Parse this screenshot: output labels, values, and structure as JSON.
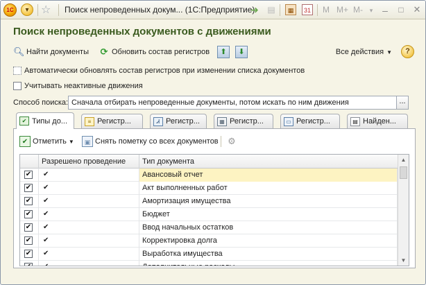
{
  "titlebar": {
    "logo": "1С",
    "title": "Поиск непроведенных докум... (1С:Предприятие)",
    "memory_buttons": [
      "M",
      "M+",
      "M-"
    ]
  },
  "heading": "Поиск непроведенных документов с движениями",
  "toolbar": {
    "find_label": "Найти документы",
    "refresh_label": "Обновить состав регистров",
    "all_actions_label": "Все действия",
    "help_label": "?"
  },
  "options": {
    "auto_refresh_label": "Автоматически обновлять состав регистров при изменении списка документов",
    "inactive_label": "Учитывать неактивные движения"
  },
  "search_mode": {
    "label": "Способ поиска:",
    "value": "Сначала отбирать непроведенные документы, потом искать по ним движения",
    "button": "..."
  },
  "tabs": [
    {
      "label": "Типы до...",
      "icon": "document-types-icon"
    },
    {
      "label": "Регистр...",
      "icon": "register-icon"
    },
    {
      "label": "Регистр...",
      "icon": "accounting-register-icon"
    },
    {
      "label": "Регистр...",
      "icon": "calculation-register-icon"
    },
    {
      "label": "Регистр...",
      "icon": "information-register-icon"
    },
    {
      "label": "Найден...",
      "icon": "found-documents-icon"
    }
  ],
  "panel_toolbar": {
    "mark_label": "Отметить",
    "unmark_label": "Снять пометку со всех документов"
  },
  "grid": {
    "columns": [
      "Разрешено проведение",
      "Тип документа"
    ],
    "rows": [
      {
        "checked": "✔",
        "allowed": "✔",
        "type": "Авансовый отчет"
      },
      {
        "checked": "✔",
        "allowed": "✔",
        "type": "Акт выполненных работ"
      },
      {
        "checked": "✔",
        "allowed": "✔",
        "type": "Амортизация имущества"
      },
      {
        "checked": "✔",
        "allowed": "✔",
        "type": "Бюджет"
      },
      {
        "checked": "✔",
        "allowed": "✔",
        "type": "Ввод начальных остатков"
      },
      {
        "checked": "✔",
        "allowed": "✔",
        "type": "Корректировка долга"
      },
      {
        "checked": "✔",
        "allowed": "✔",
        "type": "Выработка имущества"
      },
      {
        "checked": "✔",
        "allowed": "✔",
        "type": "Дополнительные расходы"
      }
    ]
  }
}
